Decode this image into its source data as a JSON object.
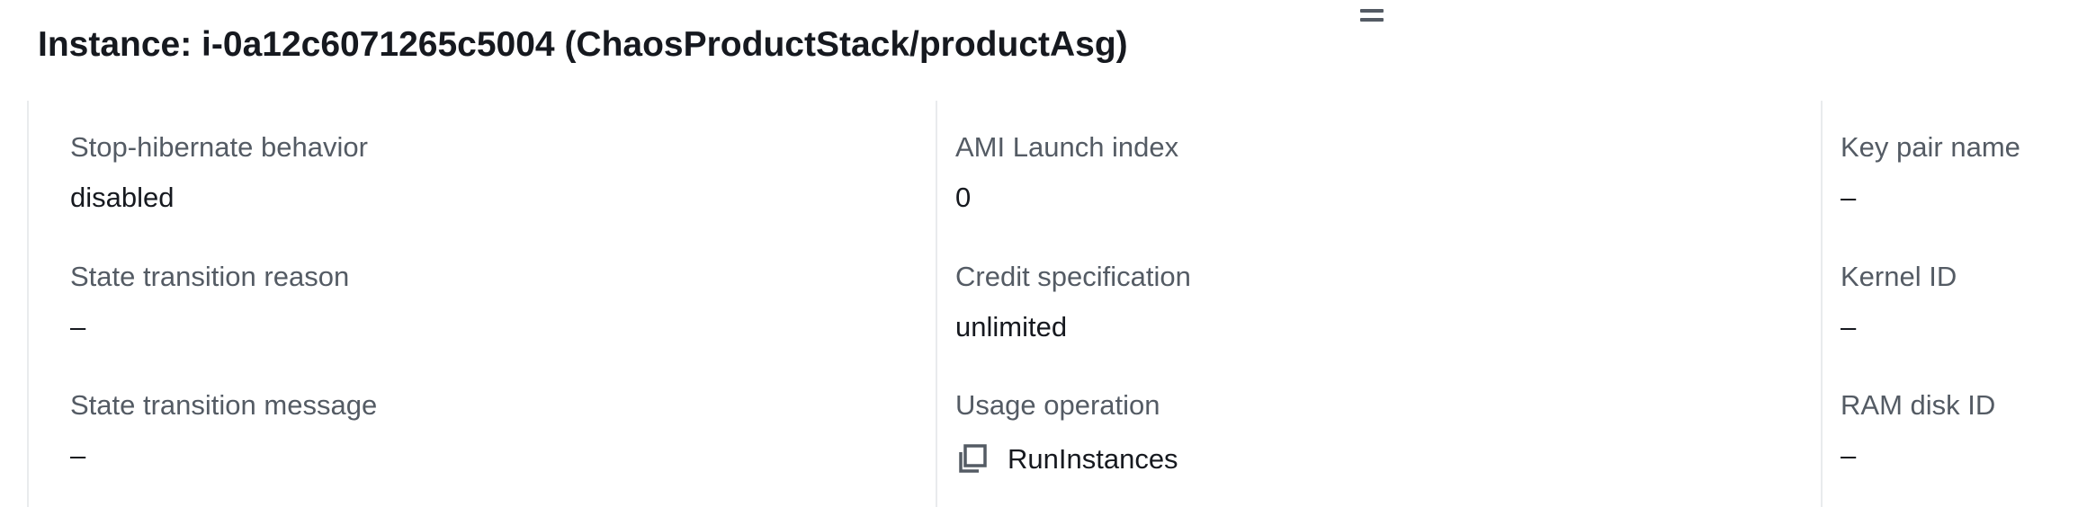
{
  "header": {
    "title": "Instance: i-0a12c6071265c5004 (ChaosProductStack/productAsg)"
  },
  "details": {
    "col1": [
      {
        "label": "Stop-hibernate behavior",
        "value": "disabled"
      },
      {
        "label": "State transition reason",
        "value": "–"
      },
      {
        "label": "State transition message",
        "value": "–"
      }
    ],
    "col2": [
      {
        "label": "AMI Launch index",
        "value": "0"
      },
      {
        "label": "Credit specification",
        "value": "unlimited"
      },
      {
        "label": "Usage operation",
        "value": "RunInstances"
      }
    ],
    "col3": [
      {
        "label": "Key pair name",
        "value": "–"
      },
      {
        "label": "Kernel ID",
        "value": "–"
      },
      {
        "label": "RAM disk ID",
        "value": "–"
      }
    ]
  },
  "icons": {
    "resize": "drag-handle-icon",
    "copy": "copy-icon"
  }
}
